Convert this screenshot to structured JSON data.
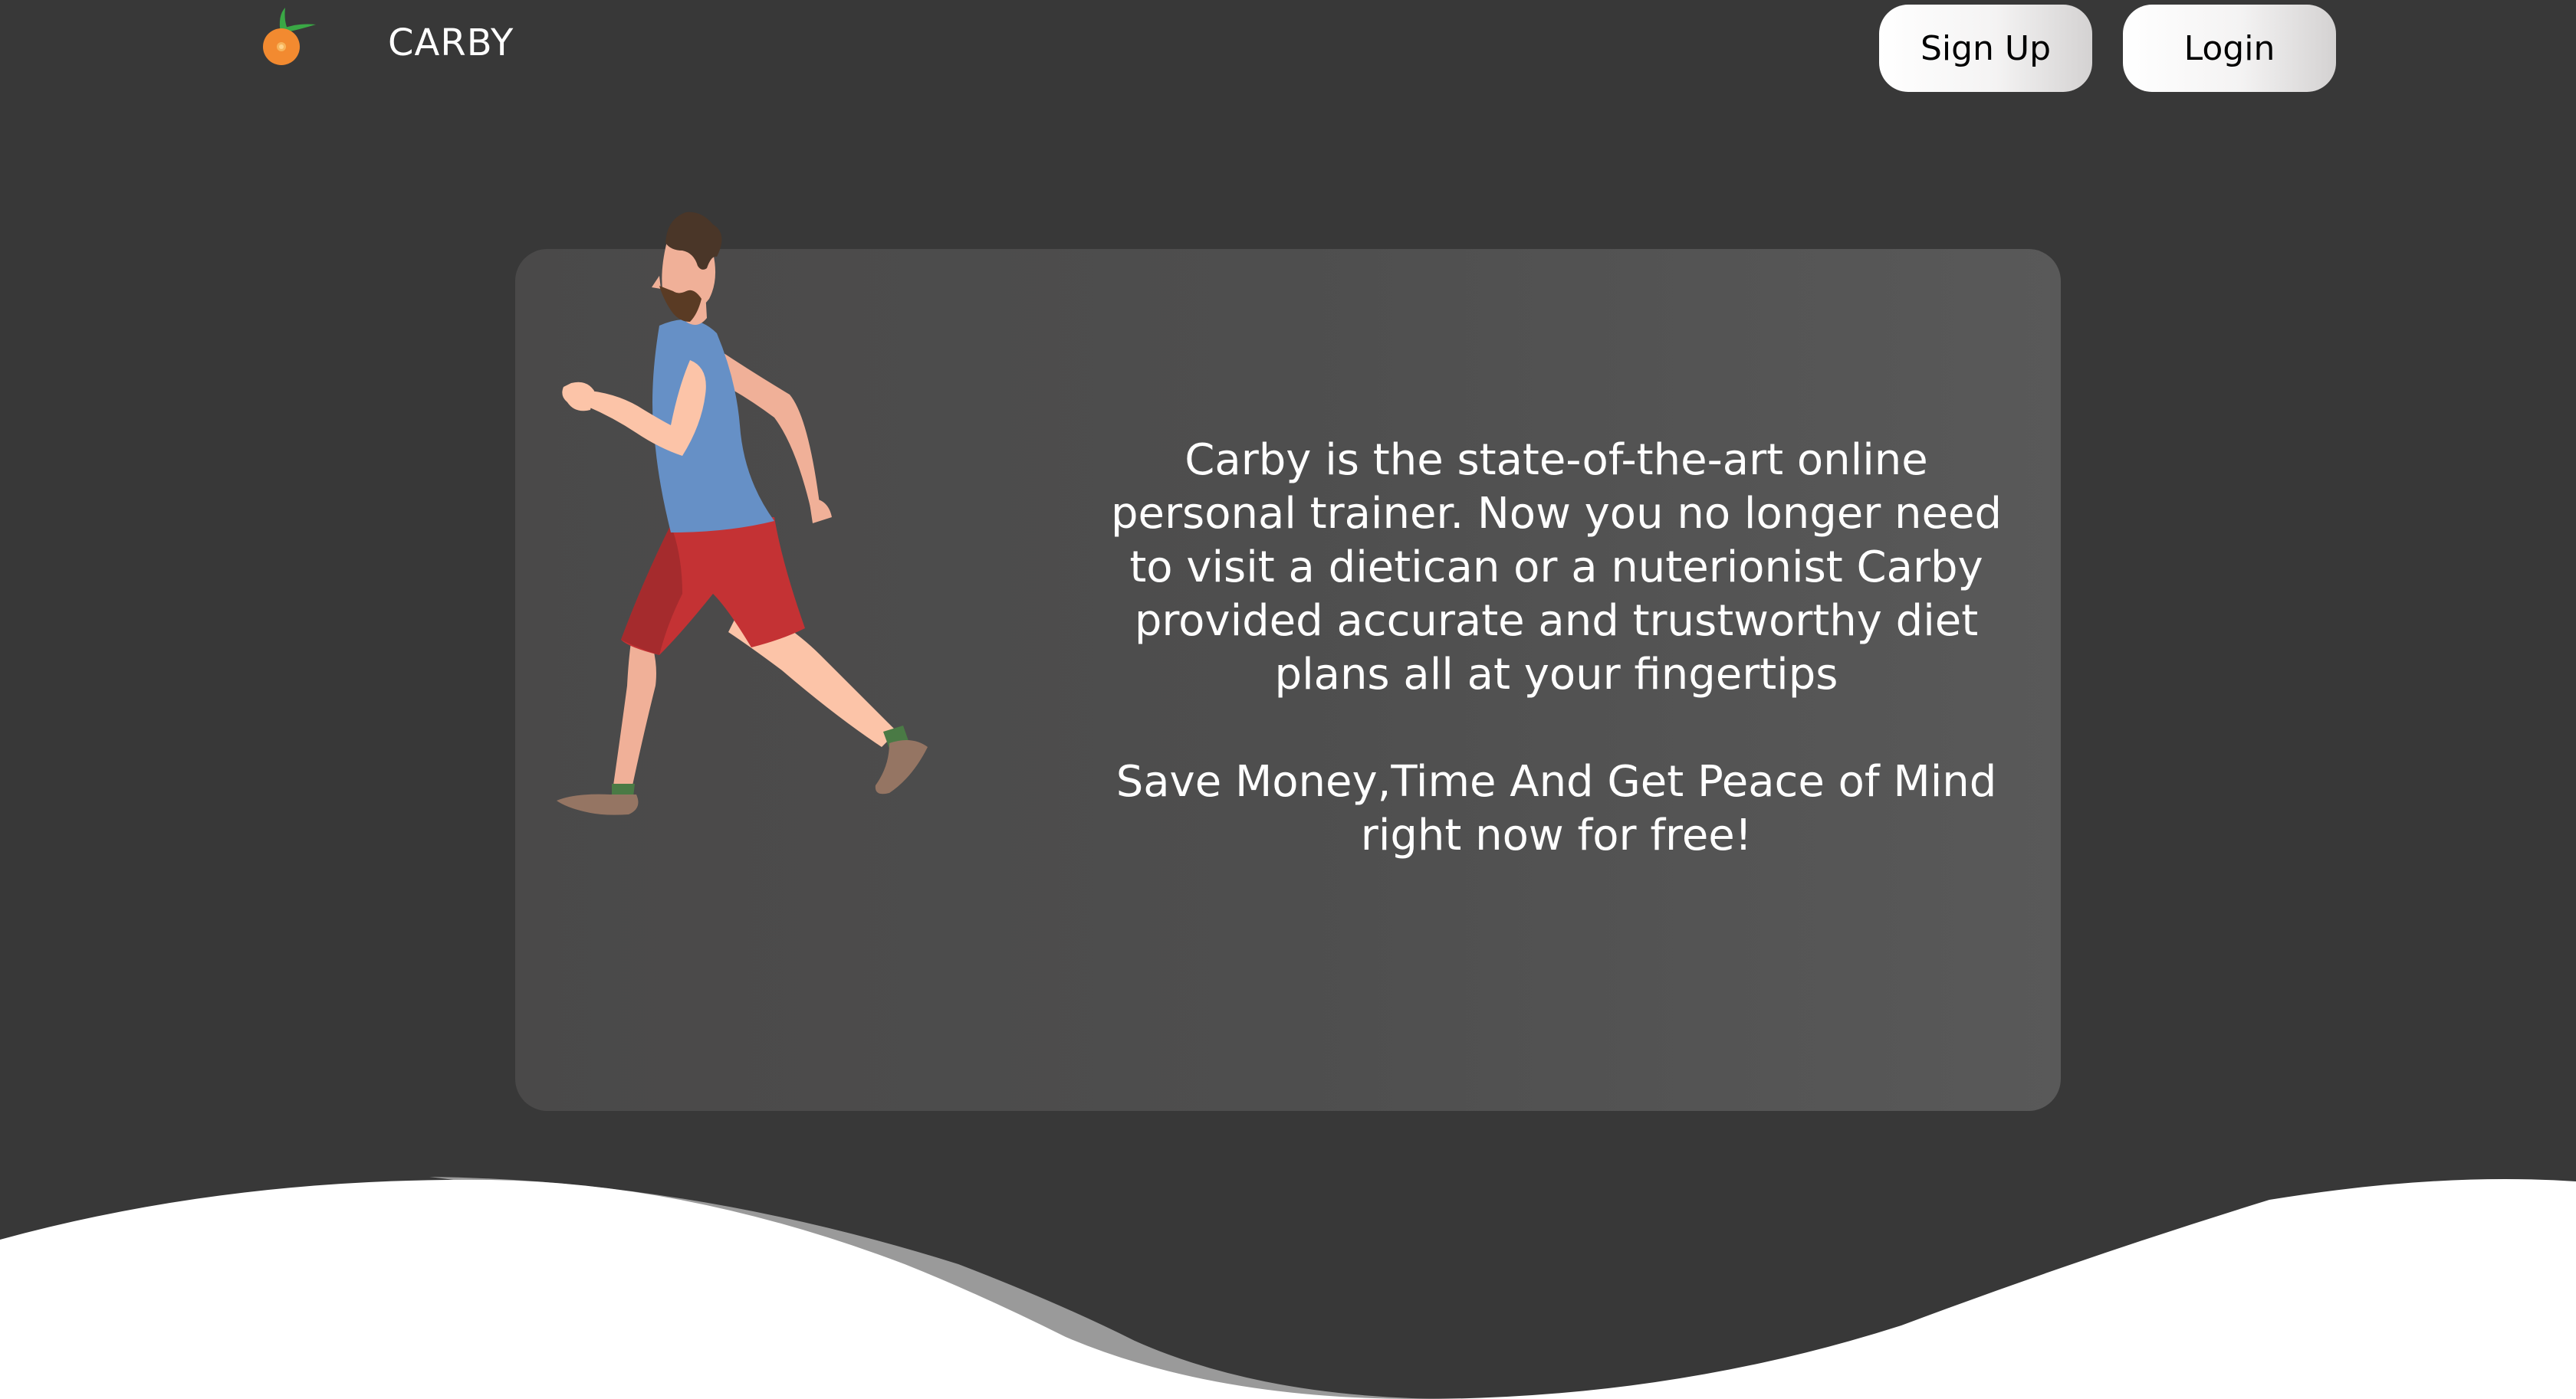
{
  "header": {
    "brand": "CARBY",
    "signup_label": "Sign Up",
    "login_label": "Login"
  },
  "hero": {
    "description": "Carby is the state-of-the-art online personal trainer. Now you no longer need to visit a dietican or a nuterionist Carby provided accurate and trustworthy diet plans all at your fingertips",
    "tagline": "Save Money,Time And Get Peace of Mind right now for free!"
  },
  "colors": {
    "background": "#383838",
    "card": "#4e4e4e",
    "button": "#ffffff",
    "logo_fruit": "#f28a30",
    "logo_leaf": "#3aa845"
  },
  "icons": {
    "logo": "orange-fruit-icon",
    "illustration": "running-man-illustration"
  }
}
